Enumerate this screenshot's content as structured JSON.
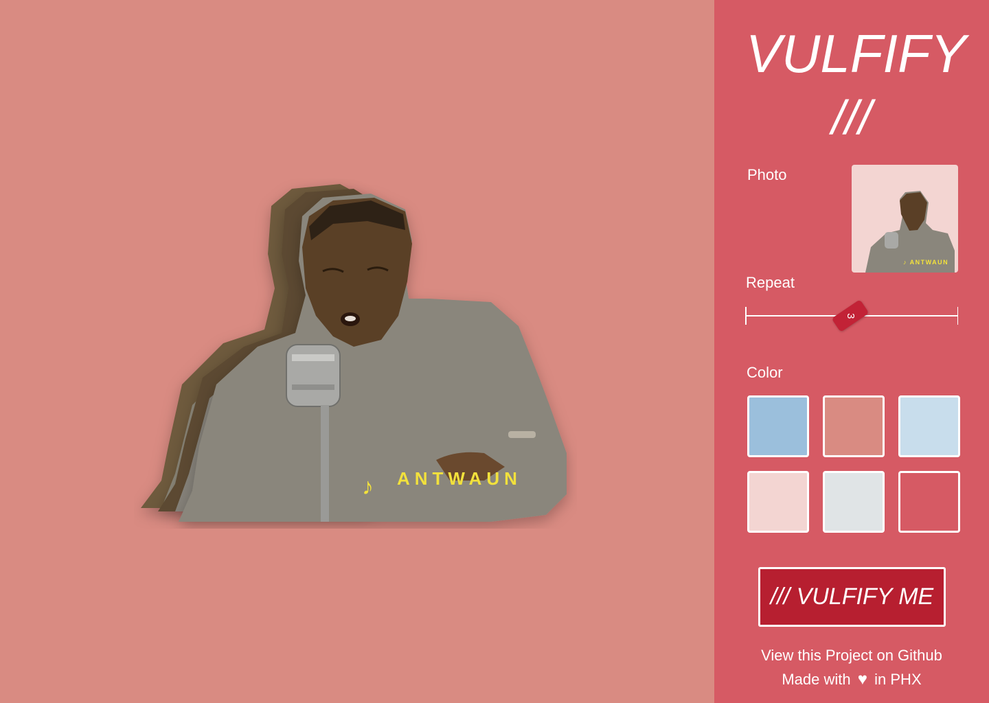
{
  "colors": {
    "canvas_bg": "#d98b82",
    "panel_bg": "#d65a64",
    "button_bg": "#b71f30",
    "handle_bg": "#c22236",
    "thumb_bg": "#f3d5d2",
    "caption": "#f2e13c"
  },
  "header": {
    "title": "VULFIFY",
    "mark": "///"
  },
  "photo": {
    "label": "Photo",
    "caption_icon": "music-note-icon",
    "caption_text": "ANTWAUN"
  },
  "repeat": {
    "label": "Repeat",
    "value": "3",
    "min": 1,
    "max": 10,
    "current": 3
  },
  "color": {
    "label": "Color",
    "swatches": [
      {
        "hex": "#9bbfdc",
        "selected": false
      },
      {
        "hex": "#d98b82",
        "selected": true
      },
      {
        "hex": "#c8ddec",
        "selected": false
      },
      {
        "hex": "#f3d5d2",
        "selected": false
      },
      {
        "hex": "#e0e4e6",
        "selected": false
      },
      {
        "hex": "#d65a64",
        "selected": false
      }
    ]
  },
  "actions": {
    "vulfify_label": "/// VULFIFY ME"
  },
  "footer": {
    "github_text": "View this Project on Github",
    "made_prefix": "Made with",
    "heart_icon": "heart-icon",
    "made_suffix": "in PHX"
  }
}
